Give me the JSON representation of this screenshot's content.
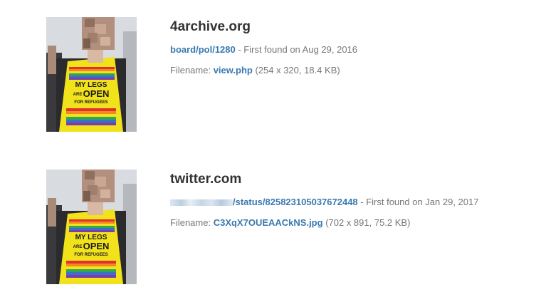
{
  "results": [
    {
      "site": "4archive.org",
      "page_link": "board/pol/1280",
      "found_text": " - First found on Aug 29, 2016",
      "filename_label": "Filename: ",
      "filename": "view.php",
      "file_meta": " (254 x 320, 18.4 KB)",
      "thumbnail": {
        "sign_line1": "MY LEGS",
        "sign_line2_small": "ARE",
        "sign_line2": "OPEN",
        "sign_line3": "FOR REFUGEES"
      }
    },
    {
      "site": "twitter.com",
      "page_link": "/status/825823105037672448",
      "found_text": " - First found on Jan 29, 2017",
      "filename_label": "Filename: ",
      "filename": "C3XqX7OUEAACkNS.jpg",
      "file_meta": " (702 x 891, 75.2 KB)",
      "thumbnail": {
        "sign_line1": "MY LEGS",
        "sign_line2_small": "ARE",
        "sign_line2": "OPEN",
        "sign_line3": "FOR REFUGEES"
      }
    }
  ],
  "colors": {
    "link": "#3a79b0",
    "site_title": "#333333",
    "body_text": "#777777",
    "vest_yellow": "#f2e21c"
  }
}
